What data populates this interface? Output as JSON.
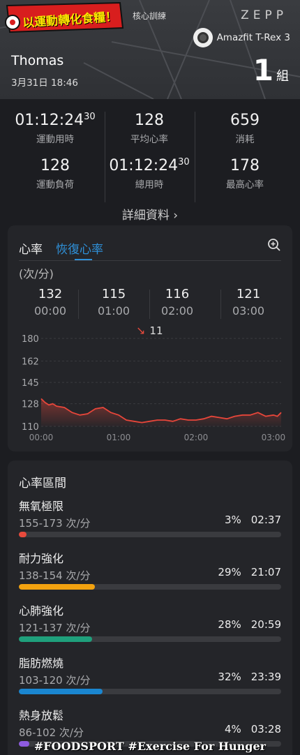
{
  "header": {
    "logo_text": "以運動轉化食糧！",
    "workout_type": "核心訓練",
    "brand": "ZEPP",
    "device": "Amazfit T-Rex 3",
    "user_name": "Thomas",
    "date_time": "3月31日 18:46",
    "sets_count": "1",
    "sets_unit": "組"
  },
  "stats": {
    "duration": {
      "main": "01:12:24",
      "sup": "30",
      "label": "運動用時"
    },
    "avg_hr": {
      "value": "128",
      "label": "平均心率"
    },
    "calories": {
      "value": "659",
      "label": "消耗"
    },
    "training_load": {
      "value": "128",
      "label": "運動負荷"
    },
    "total_time": {
      "main": "01:12:24",
      "sup": "30",
      "label": "總用時"
    },
    "max_hr": {
      "value": "178",
      "label": "最高心率"
    },
    "details_link": "詳細資料 ›"
  },
  "hr_card": {
    "tab_hr": "心率",
    "tab_recovery": "恢復心率",
    "unit": "(次/分)",
    "columns": [
      {
        "value": "132",
        "time": "00:00"
      },
      {
        "value": "115",
        "time": "01:00"
      },
      {
        "value": "116",
        "time": "02:00"
      },
      {
        "value": "121",
        "time": "03:00"
      }
    ],
    "drop_value": "11",
    "colors": {
      "line": "#e8463a",
      "accent": "#2f90d8"
    }
  },
  "chart_data": {
    "type": "area",
    "title": "",
    "xlabel": "",
    "ylabel": "(次/分)",
    "y_ticks": [
      "180",
      "162",
      "145",
      "128",
      "110"
    ],
    "x_ticks": [
      "00:00",
      "01:00",
      "02:00",
      "03:00"
    ],
    "ylim": [
      110,
      180
    ],
    "xlim": [
      0,
      3.1
    ],
    "series": [
      {
        "x": [
          0.0,
          0.05,
          0.1,
          0.15,
          0.2,
          0.3,
          0.4,
          0.5,
          0.6,
          0.7,
          0.8,
          0.9,
          1.0,
          1.1,
          1.2,
          1.3,
          1.4,
          1.5,
          1.6,
          1.7,
          1.8,
          1.9,
          2.0,
          2.1,
          2.2,
          2.3,
          2.4,
          2.5,
          2.6,
          2.7,
          2.8,
          2.9,
          3.0,
          3.05,
          3.1
        ],
        "y": [
          132,
          129,
          127,
          128,
          126,
          125,
          121,
          119,
          120,
          124,
          125,
          121,
          119,
          115,
          114,
          113,
          114,
          115,
          115,
          114,
          116,
          115,
          115,
          116,
          118,
          117,
          116,
          118,
          119,
          119,
          121,
          118,
          119,
          118,
          121
        ]
      }
    ]
  },
  "zones": {
    "title": "心率區間",
    "items": [
      {
        "name": "無氧極限",
        "range": "155-173 次/分",
        "percent": "3%",
        "time": "02:37",
        "fraction": 0.03,
        "color": "#e84a3c"
      },
      {
        "name": "耐力強化",
        "range": "138-154 次/分",
        "percent": "29%",
        "time": "21:07",
        "fraction": 0.29,
        "color": "#f2a20f"
      },
      {
        "name": "心肺強化",
        "range": "121-137 次/分",
        "percent": "28%",
        "time": "20:59",
        "fraction": 0.28,
        "color": "#1fa07c"
      },
      {
        "name": "脂肪燃燒",
        "range": "103-120 次/分",
        "percent": "32%",
        "time": "23:39",
        "fraction": 0.32,
        "color": "#1a86d0"
      },
      {
        "name": "熱身放鬆",
        "range": "86-102 次/分",
        "percent": "4%",
        "time": "03:28",
        "fraction": 0.04,
        "color": "#8e5be0"
      }
    ]
  },
  "watermark": "#FOODSPORT #Exercise For Hunger"
}
